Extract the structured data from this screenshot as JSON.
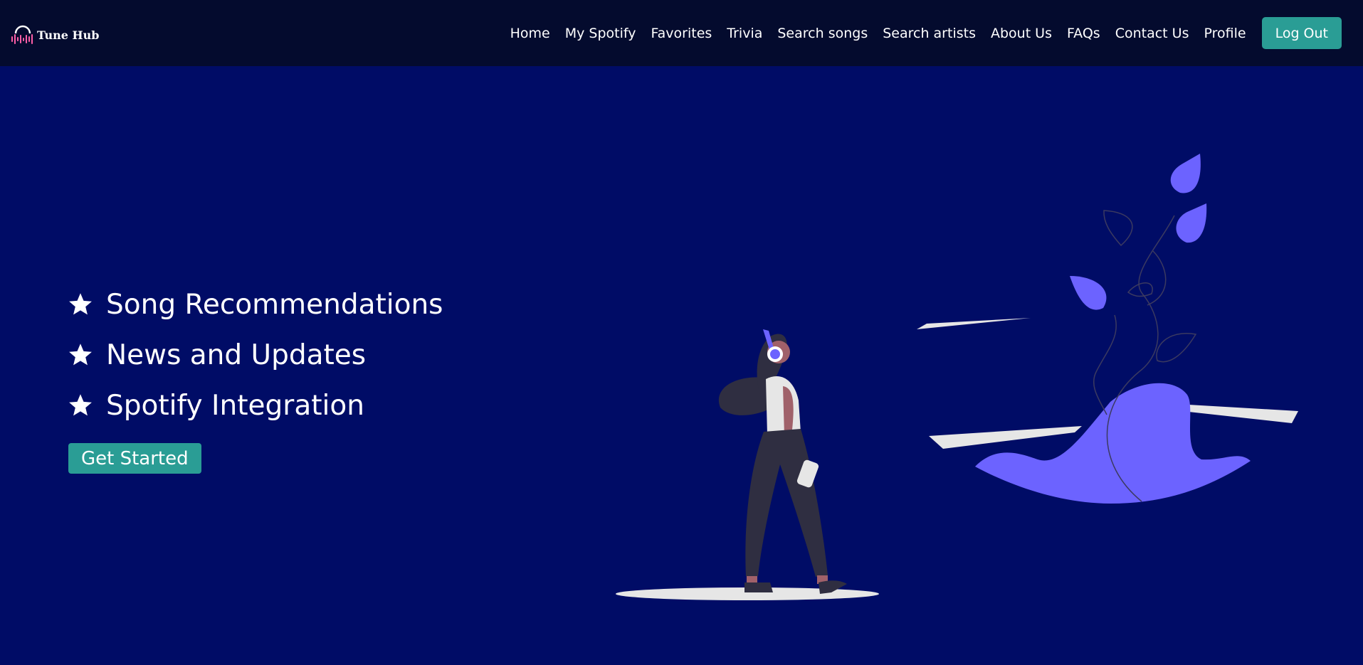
{
  "brand": {
    "name": "Tune Hub",
    "icon": "headphones-equalizer-icon",
    "icon_colors": [
      "#ffffff",
      "#ff5fa8"
    ]
  },
  "nav": {
    "links": [
      "Home",
      "My Spotify",
      "Favorites",
      "Trivia",
      "Search songs",
      "Search artists",
      "About Us",
      "FAQs",
      "Contact Us",
      "Profile"
    ],
    "logout_label": "Log Out"
  },
  "hero": {
    "features": [
      {
        "icon": "star-icon",
        "label": "Song Recommendations"
      },
      {
        "icon": "star-icon",
        "label": "News and Updates"
      },
      {
        "icon": "star-icon",
        "label": "Spotify Integration"
      }
    ],
    "cta_label": "Get Started"
  },
  "colors": {
    "navbar_bg": "#040b2e",
    "hero_bg": "#000c66",
    "accent": "#2a9d95",
    "illustration_primary": "#6c63ff",
    "illustration_dark": "#2f2e41",
    "illustration_skin": "#a0616a",
    "illustration_light": "#e6e6e6"
  }
}
